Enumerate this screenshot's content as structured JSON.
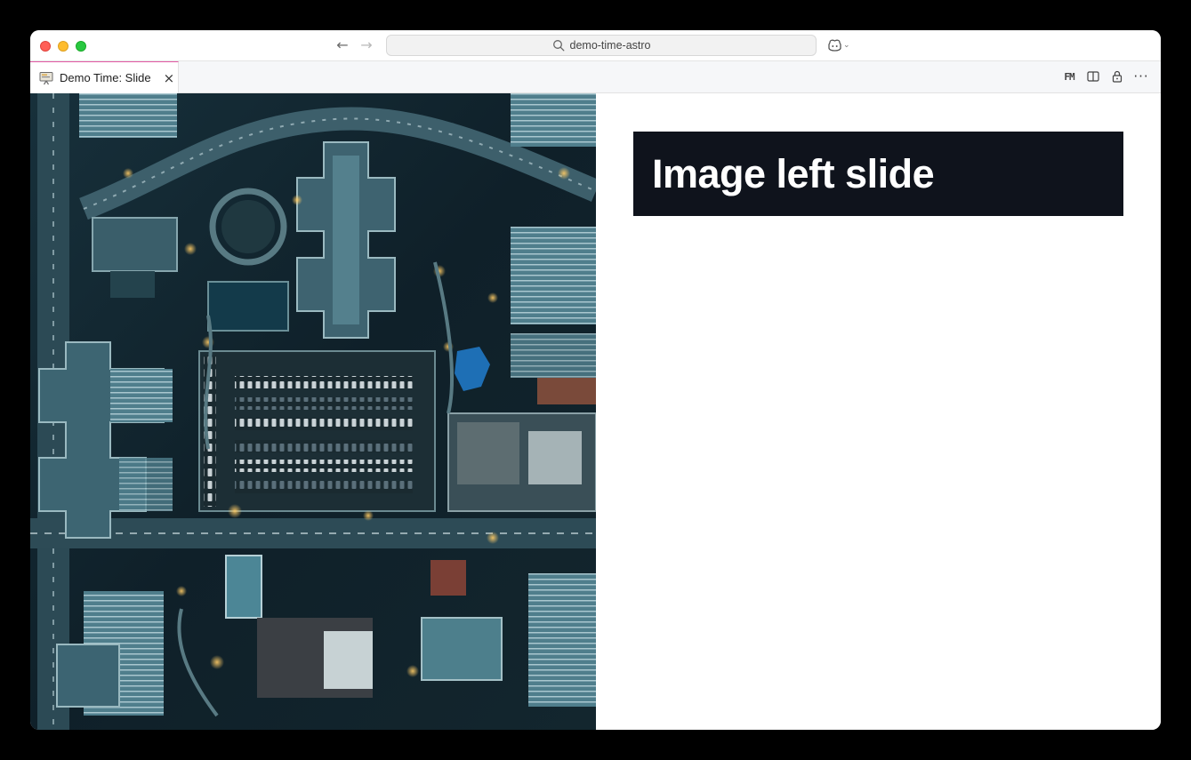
{
  "browser": {
    "url": "demo-time-astro",
    "nav": {
      "back_icon": "arrow-left-icon",
      "forward_icon": "arrow-right-icon"
    }
  },
  "tab": {
    "label": "Demo Time: Slide",
    "icon": "demo-time-icon",
    "accent_color": "#e35aa6"
  },
  "tab_actions": {
    "fm_label": "FM",
    "items": [
      "front-matter-icon",
      "split-editor-icon",
      "lock-icon",
      "more-icon"
    ]
  },
  "slide": {
    "title": "Image left slide",
    "image": "aerial-city-parking-lot-image",
    "title_bg": "#0f131c"
  }
}
